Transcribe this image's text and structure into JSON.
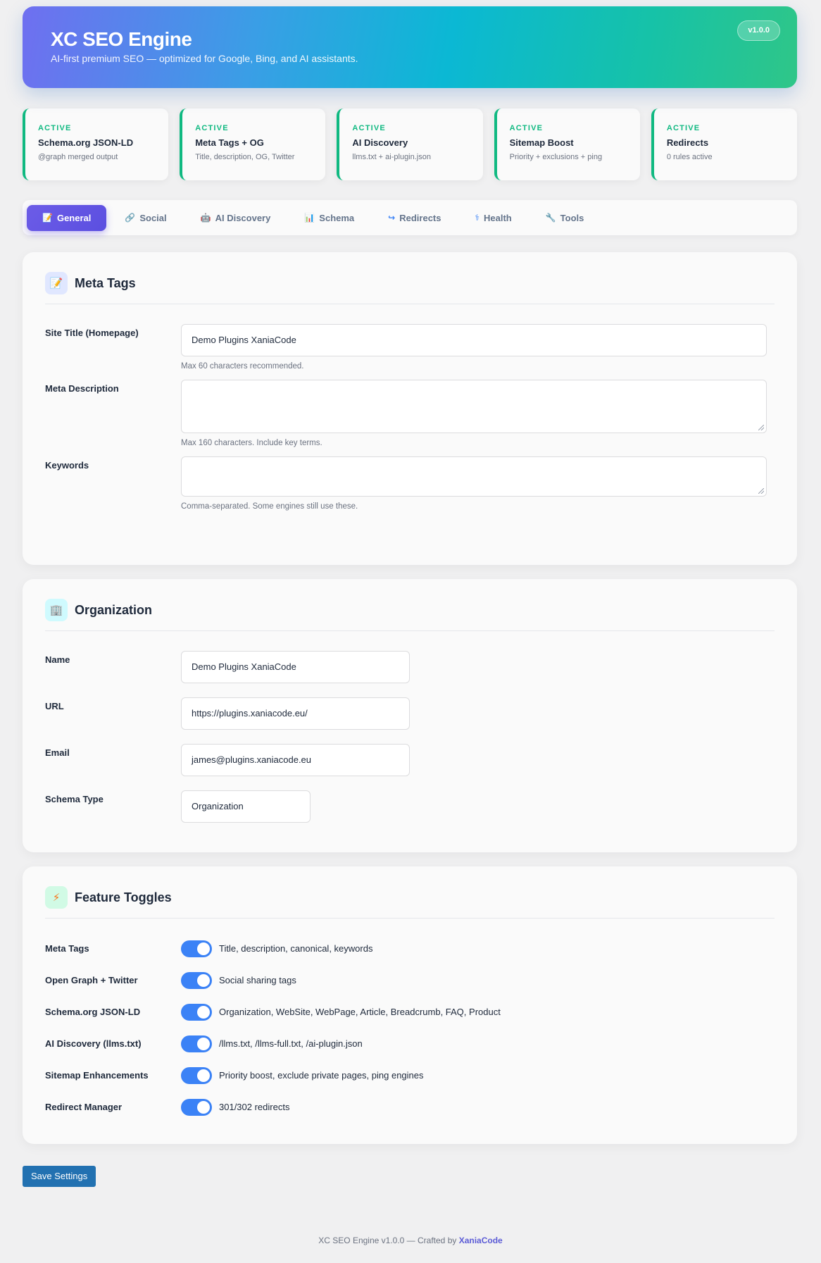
{
  "header": {
    "title": "XC SEO Engine",
    "subtitle": "AI-first premium SEO — optimized for Google, Bing, and AI assistants.",
    "version": "v1.0.0"
  },
  "cards": [
    {
      "status": "ACTIVE",
      "title": "Schema.org JSON-LD",
      "desc": "@graph merged output"
    },
    {
      "status": "ACTIVE",
      "title": "Meta Tags + OG",
      "desc": "Title, description, OG, Twitter"
    },
    {
      "status": "ACTIVE",
      "title": "AI Discovery",
      "desc": "llms.txt + ai-plugin.json"
    },
    {
      "status": "ACTIVE",
      "title": "Sitemap Boost",
      "desc": "Priority + exclusions + ping"
    },
    {
      "status": "ACTIVE",
      "title": "Redirects",
      "desc": "0 rules active"
    }
  ],
  "tabs": [
    {
      "label": "General",
      "icon": "memo-icon",
      "glyph": "📝"
    },
    {
      "label": "Social",
      "icon": "link-icon",
      "glyph": "🔗"
    },
    {
      "label": "AI Discovery",
      "icon": "robot-icon",
      "glyph": "🤖"
    },
    {
      "label": "Schema",
      "icon": "chart-icon",
      "glyph": "📊"
    },
    {
      "label": "Redirects",
      "icon": "redirect-arrow-icon",
      "glyph": "↪"
    },
    {
      "label": "Health",
      "icon": "stethoscope-icon",
      "glyph": "⚕"
    },
    {
      "label": "Tools",
      "icon": "wrench-icon",
      "glyph": "🔧"
    }
  ],
  "meta": {
    "title": "Meta Tags",
    "icon": "memo-icon",
    "site_title_label": "Site Title (Homepage)",
    "site_title_value": "Demo Plugins XaniaCode",
    "site_title_hint": "Max 60 characters recommended.",
    "description_label": "Meta Description",
    "description_value": "",
    "description_hint": "Max 160 characters. Include key terms.",
    "keywords_label": "Keywords",
    "keywords_value": "",
    "keywords_hint": "Comma-separated. Some engines still use these."
  },
  "organization": {
    "title": "Organization",
    "icon": "building-icon",
    "name_label": "Name",
    "name_value": "Demo Plugins XaniaCode",
    "url_label": "URL",
    "url_value": "https://plugins.xaniacode.eu/",
    "email_label": "Email",
    "email_value": "james@plugins.xaniacode.eu",
    "schema_type_label": "Schema Type",
    "schema_type_value": "Organization"
  },
  "features": {
    "title": "Feature Toggles",
    "icon": "lightning-icon",
    "items": [
      {
        "label": "Meta Tags",
        "desc": "Title, description, canonical, keywords",
        "on": true
      },
      {
        "label": "Open Graph + Twitter",
        "desc": "Social sharing tags",
        "on": true
      },
      {
        "label": "Schema.org JSON-LD",
        "desc": "Organization, WebSite, WebPage, Article, Breadcrumb, FAQ, Product",
        "on": true
      },
      {
        "label": "AI Discovery (llms.txt)",
        "desc": "/llms.txt, /llms-full.txt, /ai-plugin.json",
        "on": true
      },
      {
        "label": "Sitemap Enhancements",
        "desc": "Priority boost, exclude private pages, ping engines",
        "on": true
      },
      {
        "label": "Redirect Manager",
        "desc": "301/302 redirects",
        "on": true
      }
    ]
  },
  "save_label": "Save Settings",
  "footer": {
    "text": "XC SEO Engine v1.0.0 — Crafted by ",
    "link": "XaniaCode"
  },
  "colors": {
    "accent": "#5b4fe0",
    "active_green": "#10b981",
    "toggle_blue": "#3b82f6",
    "save_blue": "#2271b1"
  }
}
